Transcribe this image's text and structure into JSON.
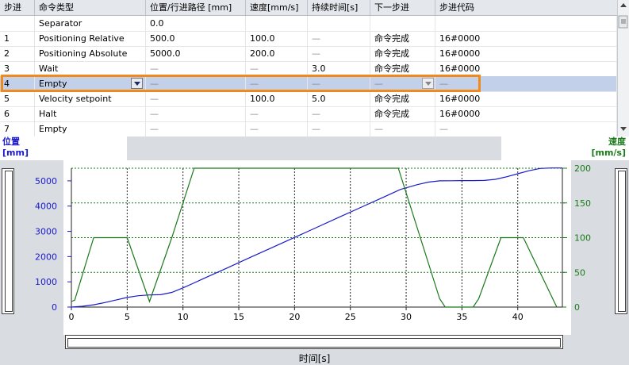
{
  "table": {
    "columns": [
      "步进",
      "命令类型",
      "位置/行进路径 [mm]",
      "速度[mm/s]",
      "持续时间[s]",
      "下一步进",
      "步进代码"
    ],
    "rows": [
      {
        "step": "",
        "command": "Separator",
        "position": "0.0",
        "speed": "",
        "duration": "",
        "next": "",
        "code": ""
      },
      {
        "step": "1",
        "command": "Positioning Relative",
        "position": "500.0",
        "speed": "100.0",
        "duration": "—",
        "next": "命令完成",
        "code": "16#0000"
      },
      {
        "step": "2",
        "command": "Positioning Absolute",
        "position": "5000.0",
        "speed": "200.0",
        "duration": "—",
        "next": "命令完成",
        "code": "16#0000"
      },
      {
        "step": "3",
        "command": "Wait",
        "position": "—",
        "speed": "—",
        "duration": "3.0",
        "next": "命令完成",
        "code": "16#0000"
      },
      {
        "step": "4",
        "command": "Empty",
        "position": "—",
        "speed": "—",
        "duration": "—",
        "next": "—",
        "code": "—",
        "selected": true
      },
      {
        "step": "5",
        "command": "Velocity setpoint",
        "position": "—",
        "speed": "100.0",
        "duration": "5.0",
        "next": "命令完成",
        "code": "16#0000"
      },
      {
        "step": "6",
        "command": "Halt",
        "position": "—",
        "speed": "—",
        "duration": "—",
        "next": "命令完成",
        "code": "16#0000"
      },
      {
        "step": "7",
        "command": "Empty",
        "position": "—",
        "speed": "—",
        "duration": "—",
        "next": "—",
        "code": "—"
      }
    ]
  },
  "chart": {
    "left_label": "位置",
    "left_unit": "[mm]",
    "right_label": "速度",
    "right_unit": "[mm/s]",
    "xlabel": "时间[s]"
  },
  "colors": {
    "position": "#1a1acc",
    "speed": "#1a7a1a",
    "selection": "#f08a1c"
  },
  "chart_data": {
    "type": "line",
    "xlabel": "时间[s]",
    "xlim": [
      0,
      44
    ],
    "x_ticks": [
      0,
      5,
      10,
      15,
      20,
      25,
      30,
      35,
      40
    ],
    "y_left": {
      "label": "位置 [mm]",
      "lim": [
        0,
        5500
      ],
      "ticks": [
        0,
        1000,
        2000,
        3000,
        4000,
        5000
      ]
    },
    "y_right": {
      "label": "速度 [mm/s]",
      "lim": [
        0,
        200
      ],
      "ticks": [
        0,
        50,
        100,
        150,
        200
      ]
    },
    "grid": true,
    "series": [
      {
        "axis": "left",
        "color": "#1a1acc",
        "x": [
          0,
          1,
          2,
          3,
          4,
          5,
          6,
          7,
          8,
          9,
          10,
          11,
          12,
          14,
          16,
          18,
          20,
          22,
          24,
          26,
          28,
          29.5,
          31,
          32,
          33,
          34,
          35,
          36,
          37,
          38,
          39,
          40,
          41,
          42,
          43,
          44
        ],
        "y": [
          0,
          30,
          90,
          180,
          280,
          380,
          450,
          480,
          490,
          580,
          760,
          960,
          1160,
          1560,
          1960,
          2360,
          2760,
          3160,
          3560,
          3960,
          4360,
          4660,
          4850,
          4950,
          5000,
          5005,
          5010,
          5010,
          5015,
          5060,
          5160,
          5280,
          5400,
          5490,
          5510,
          5510
        ]
      },
      {
        "axis": "right",
        "color": "#1a7a1a",
        "x": [
          0,
          0.3,
          2,
          5,
          7,
          9,
          11,
          29.3,
          33,
          33.5,
          36,
          36.5,
          38.5,
          40.5,
          43.2,
          43.5
        ],
        "y": [
          8,
          10,
          100,
          100,
          8,
          100,
          200,
          200,
          12,
          0,
          0,
          12,
          100,
          100,
          10,
          0
        ]
      }
    ]
  }
}
